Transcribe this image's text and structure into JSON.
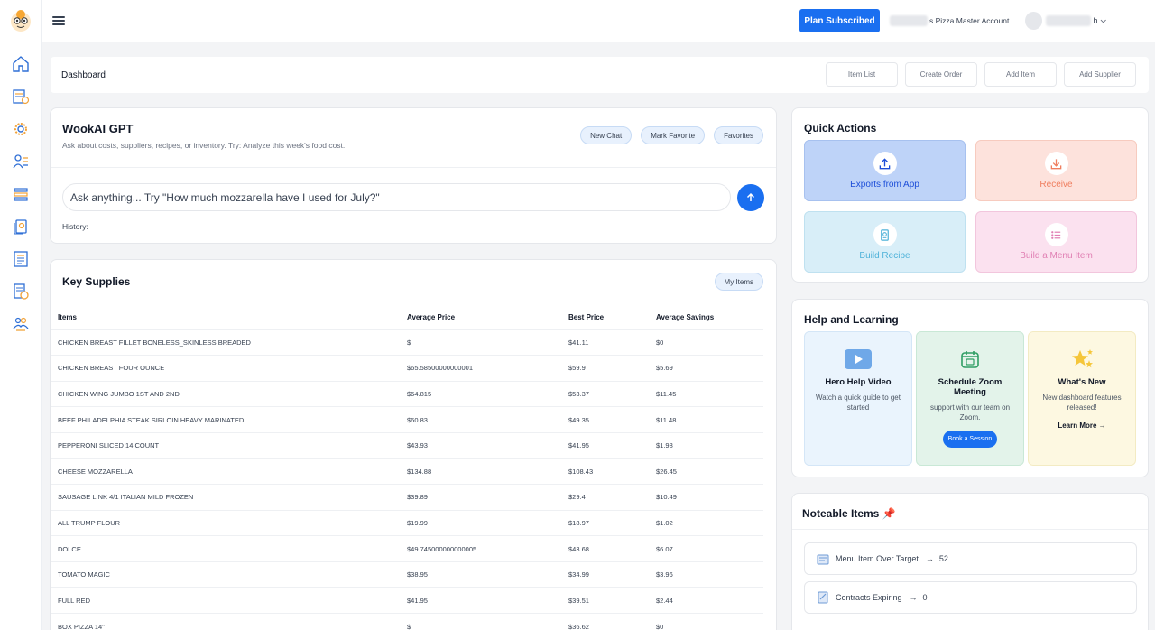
{
  "colors": {
    "accent": "#1a6ff0",
    "sidebar_icon": "#2f6fd6",
    "sidebar_icon_accent": "#f2a33a"
  },
  "sidebar": {
    "items": [
      {
        "icon": "home-icon"
      },
      {
        "icon": "invoices-icon"
      },
      {
        "icon": "settings-gear-icon"
      },
      {
        "icon": "suppliers-icon"
      },
      {
        "icon": "inventory-icon"
      },
      {
        "icon": "orders-icon"
      },
      {
        "icon": "reports-icon"
      },
      {
        "icon": "recipes-icon"
      },
      {
        "icon": "team-icon"
      }
    ]
  },
  "topbar": {
    "plan_button": "Plan Subscribed",
    "account_name": "s Pizza Master Account",
    "user_name_suffix": "h"
  },
  "breadcrumb": {
    "title": "Dashboard",
    "actions": [
      "Item List",
      "Create Order",
      "Add Item",
      "Add Supplier"
    ]
  },
  "gpt": {
    "title": "WookAI GPT",
    "subtitle": "Ask about costs, suppliers, recipes, or inventory. Try: Analyze this week's food cost.",
    "buttons": [
      "New Chat",
      "Mark Favorite",
      "Favorites"
    ],
    "input_placeholder": "Ask anything... Try \"How much mozzarella have I used for July?\"",
    "history_label": "History:"
  },
  "supplies": {
    "title": "Key Supplies",
    "my_items_button": "My Items",
    "columns": [
      "Items",
      "Average Price",
      "Best Price",
      "Average Savings"
    ],
    "rows": [
      [
        "CHICKEN BREAST FILLET BONELESS_SKINLESS BREADED",
        "$",
        "$41.11",
        "$0"
      ],
      [
        "CHICKEN BREAST FOUR OUNCE",
        "$65.58500000000001",
        "$59.9",
        "$5.69"
      ],
      [
        "CHICKEN WING JUMBO 1ST AND 2ND",
        "$64.815",
        "$53.37",
        "$11.45"
      ],
      [
        "BEEF PHILADELPHIA STEAK SIRLOIN HEAVY MARINATED",
        "$60.83",
        "$49.35",
        "$11.48"
      ],
      [
        "PEPPERONI SLICED 14 COUNT",
        "$43.93",
        "$41.95",
        "$1.98"
      ],
      [
        "CHEESE MOZZARELLA",
        "$134.88",
        "$108.43",
        "$26.45"
      ],
      [
        "SAUSAGE LINK 4/1 ITALIAN MILD FROZEN",
        "$39.89",
        "$29.4",
        "$10.49"
      ],
      [
        "ALL TRUMP FLOUR",
        "$19.99",
        "$18.97",
        "$1.02"
      ],
      [
        "DOLCE",
        "$49.745000000000005",
        "$43.68",
        "$6.07"
      ],
      [
        "TOMATO MAGIC",
        "$38.95",
        "$34.99",
        "$3.96"
      ],
      [
        "FULL RED",
        "$41.95",
        "$39.51",
        "$2.44"
      ],
      [
        "BOX PIZZA 14\"",
        "$",
        "$36.62",
        "$0"
      ]
    ]
  },
  "quick_actions": {
    "title": "Quick Actions",
    "tiles": [
      {
        "label": "Exports from App",
        "icon": "upload-icon"
      },
      {
        "label": "Receive",
        "icon": "download-icon"
      },
      {
        "label": "Build Recipe",
        "icon": "recipe-icon"
      },
      {
        "label": "Build a Menu Item",
        "icon": "menu-list-icon"
      }
    ]
  },
  "help": {
    "title": "Help and Learning",
    "tiles": [
      {
        "title": "Hero Help Video",
        "desc": "Watch a quick guide to get started",
        "icon": "video-play-icon"
      },
      {
        "title": "Schedule Zoom Meeting",
        "desc": "support with our team on Zoom.",
        "button": "Book a Session",
        "icon": "calendar-icon"
      },
      {
        "title": "What's New",
        "desc": "New dashboard features released!",
        "link": "Learn More →",
        "icon": "stars-icon"
      }
    ]
  },
  "noteable": {
    "title": "Noteable Items 📌",
    "items": [
      {
        "label": "Menu Item Over Target",
        "count": "52"
      },
      {
        "label": "Contracts Expiring",
        "count": "0"
      }
    ]
  }
}
